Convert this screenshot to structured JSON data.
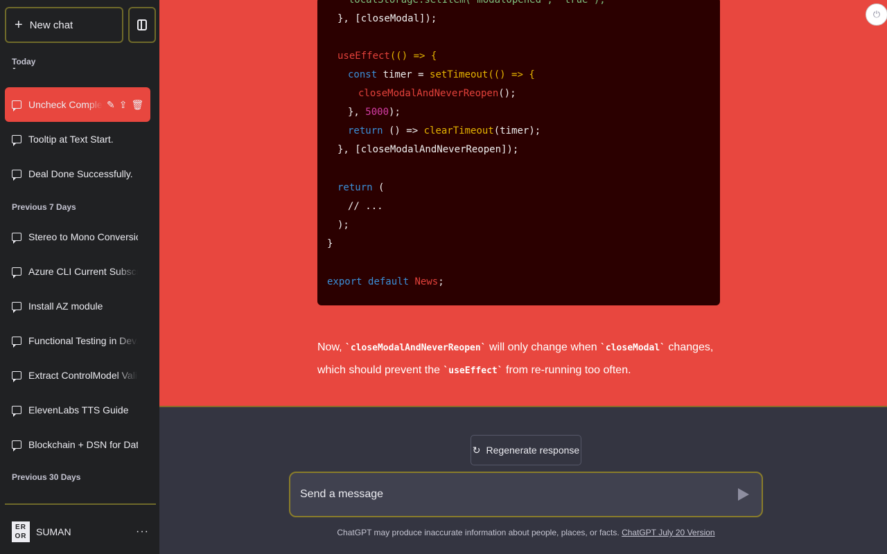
{
  "sidebar": {
    "new_chat_label": "New chat",
    "sections": {
      "today": "Today",
      "previous_7": "Previous 7 Days",
      "previous_30": "Previous 30 Days"
    },
    "today_items": [
      {
        "label": "Uncheck Complete"
      },
      {
        "label": "Tooltip at Text Start."
      },
      {
        "label": "Deal Done Successfully."
      }
    ],
    "week_items": [
      {
        "label": "Stereo to Mono Conversion"
      },
      {
        "label": "Azure CLI Current Subscripti"
      },
      {
        "label": "Install AZ module"
      },
      {
        "label": "Functional Testing in Dev/Acc"
      },
      {
        "label": "Extract ControlModel Validity"
      },
      {
        "label": "ElevenLabs TTS Guide"
      },
      {
        "label": "Blockchain + DSN for Data"
      }
    ],
    "user": {
      "avatar_text_top": "ER",
      "avatar_text_bottom": "OR",
      "name": "SUMAN",
      "more": "···"
    }
  },
  "code": {
    "l1": "  localStorage.setItem('modalOpened', 'true');",
    "l2": "}, [closeModal]);",
    "l3a": "useEffect",
    "l3b": "(() => {",
    "l4a": "const",
    "l4b": " timer = ",
    "l4c": "setTimeout",
    "l4d": "(() => {",
    "l5a": "closeModalAndNeverReopen",
    "l5b": "();",
    "l6a": "}, ",
    "l6b": "5000",
    "l6c": ");",
    "l7a": "return",
    "l7b": " () => ",
    "l7c": "clearTimeout",
    "l7d": "(timer);",
    "l8": "}, [closeModalAndNeverReopen]);",
    "l9a": "return",
    "l9b": " (",
    "l10": "// ...",
    "l11": ");",
    "l12": "}",
    "l13a": "export",
    "l13b": "default",
    "l13c": "News",
    "l13d": ";"
  },
  "response": {
    "p1": "Now, ",
    "c1": "`closeModalAndNeverReopen`",
    "p2": " will only change when ",
    "c2": "`closeModal`",
    "p3": " changes, which should prevent the ",
    "c3": "`useEffect`",
    "p4": " from re-running too often."
  },
  "composer": {
    "regenerate_label": "Regenerate response",
    "placeholder": "Send a message",
    "disclaimer": "ChatGPT may produce inaccurate information about people, places, or facts.",
    "version_link": "ChatGPT July 20 Version"
  },
  "colors": {
    "accent": "#e8473f",
    "sidebar_bg": "#202123",
    "main_bg": "#343541",
    "code_bg": "#2b0000"
  }
}
